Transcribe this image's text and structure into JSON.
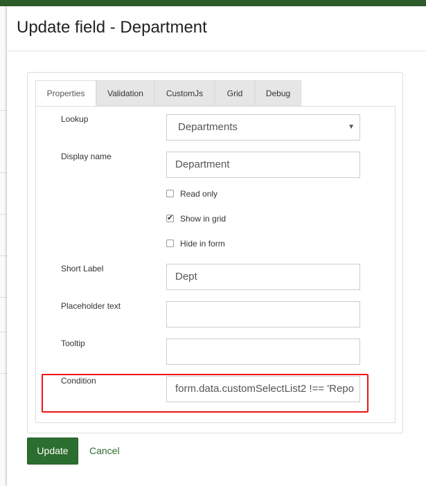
{
  "modal": {
    "title": "Update field - Department"
  },
  "tabs": [
    {
      "label": "Properties",
      "active": true
    },
    {
      "label": "Validation",
      "active": false
    },
    {
      "label": "CustomJs",
      "active": false
    },
    {
      "label": "Grid",
      "active": false
    },
    {
      "label": "Debug",
      "active": false
    }
  ],
  "form": {
    "lookup": {
      "label": "Lookup",
      "value": "Departments"
    },
    "display_name": {
      "label": "Display name",
      "value": "Department"
    },
    "read_only": {
      "label": "Read only",
      "checked": false
    },
    "show_in_grid": {
      "label": "Show in grid",
      "checked": true
    },
    "hide_in_form": {
      "label": "Hide in form",
      "checked": false
    },
    "short_label": {
      "label": "Short Label",
      "value": "Dept"
    },
    "placeholder_text": {
      "label": "Placeholder text",
      "value": ""
    },
    "tooltip": {
      "label": "Tooltip",
      "value": ""
    },
    "condition": {
      "label": "Condition",
      "value": "form.data.customSelectList2 !== 'Repo"
    }
  },
  "buttons": {
    "update": "Update",
    "cancel": "Cancel"
  },
  "colors": {
    "highlight": "#ee1111",
    "primary": "#2c6e2f",
    "topbar": "#2d5d2a"
  }
}
